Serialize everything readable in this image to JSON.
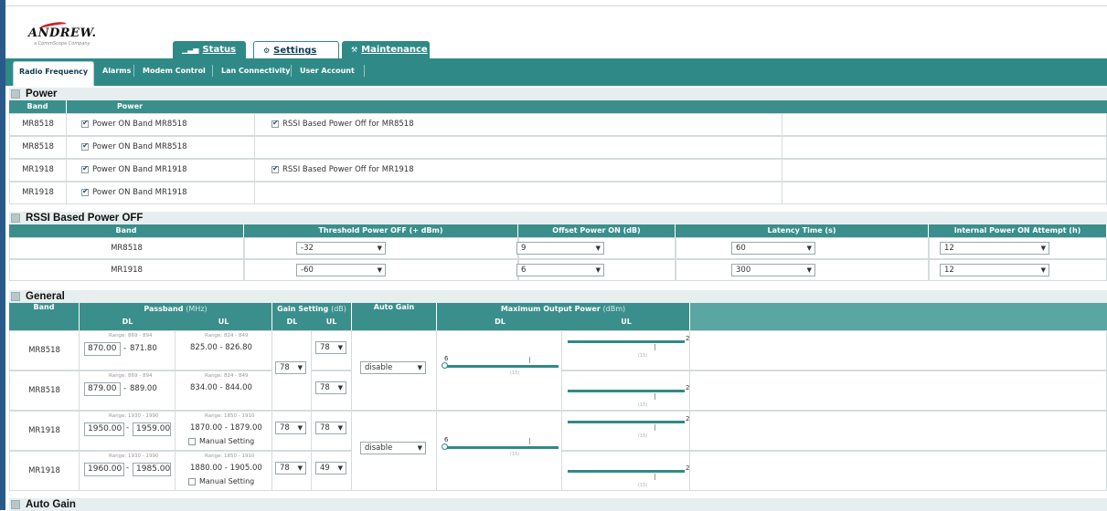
{
  "brand": {
    "name": "ANDREW.",
    "sub": "a CommScope Company"
  },
  "main_tabs": [
    {
      "label": "Status",
      "icon": "bar-chart-icon"
    },
    {
      "label": "Settings",
      "icon": "gear-icon"
    },
    {
      "label": "Maintenance",
      "icon": "wrench-icon"
    }
  ],
  "sub_tabs": [
    "Radio Frequency",
    "Alarms",
    "Modem Control",
    "Lan Connectivity",
    "User Account"
  ],
  "power": {
    "title": "Power",
    "col_band": "Band",
    "col_power": "Power",
    "rows": [
      {
        "band": "MR8518",
        "power_on": "Power ON Band MR8518",
        "power_on_checked": true,
        "rssi": "RSSI Based Power Off for MR8518",
        "rssi_checked": true
      },
      {
        "band": "MR8518",
        "power_on": "Power ON Band MR8518",
        "power_on_checked": true,
        "rssi": "",
        "rssi_checked": false
      },
      {
        "band": "MR1918",
        "power_on": "Power ON Band MR1918",
        "power_on_checked": true,
        "rssi": "RSSI Based Power Off for MR1918",
        "rssi_checked": true
      },
      {
        "band": "MR1918",
        "power_on": "Power ON Band MR1918",
        "power_on_checked": true,
        "rssi": "",
        "rssi_checked": false
      }
    ]
  },
  "rssi": {
    "title": "RSSI Based Power OFF",
    "headers": [
      "Band",
      "Threshold Power OFF (+ dBm)",
      "Offset Power ON (dB)",
      "Latency Time (s)",
      "Internal Power ON Attempt (h)"
    ],
    "rows": [
      {
        "band": "MR8518",
        "threshold": "-32",
        "offset": "9",
        "latency": "60",
        "attempt": "12"
      },
      {
        "band": "MR1918",
        "threshold": "-60",
        "offset": "6",
        "latency": "300",
        "attempt": "12"
      }
    ]
  },
  "general": {
    "title": "General",
    "h_band": "Band",
    "h_passband": "Passband",
    "h_passband_unit": "(MHz)",
    "h_dl": "DL",
    "h_ul": "UL",
    "h_gain": "Gain Setting",
    "h_gain_unit": "(dB)",
    "h_autogain": "Auto Gain",
    "h_maxout": "Maximum Output Power",
    "h_maxout_unit": "(dBm)",
    "manual_label": "Manual Setting",
    "rows": [
      {
        "band": "MR8518",
        "dl_range": "Range: 869 - 894",
        "dl_from": "870.00",
        "dl_to": "871.80",
        "ul_range": "Range: 824 - 849",
        "ul": "825.00 - 826.80",
        "gain_ul": "78",
        "manual": false
      },
      {
        "band": "MR8518",
        "dl_range": "Range: 869 - 894",
        "dl_from": "879.00",
        "dl_to": "889.00",
        "ul_range": "Range: 824 - 849",
        "ul": "834.00 - 844.00",
        "gain_ul": "78",
        "manual": false
      },
      {
        "band": "MR1918",
        "dl_range": "Range: 1930 - 1990",
        "dl_from": "1950.00",
        "dl_to": "1959.00",
        "ul_range": "Range: 1850 - 1910",
        "ul": "1870.00 - 1879.00",
        "gain_dl": "78",
        "gain_ul": "78",
        "manual": true
      },
      {
        "band": "MR1918",
        "dl_range": "Range: 1930 - 1990",
        "dl_from": "1960.00",
        "dl_to": "1985.00",
        "ul_range": "Range: 1850 - 1910",
        "ul": "1880.00 - 1905.00",
        "gain_dl": "78",
        "gain_ul": "49",
        "manual": true
      }
    ],
    "group_gain_dl": "78",
    "autogain": [
      "disable",
      "disable"
    ],
    "dl_level_label": "6",
    "ul_level_label": "2",
    "tick_label": "(15)"
  },
  "autogain_section": {
    "title": "Auto Gain"
  },
  "accent": "#2f8a87"
}
